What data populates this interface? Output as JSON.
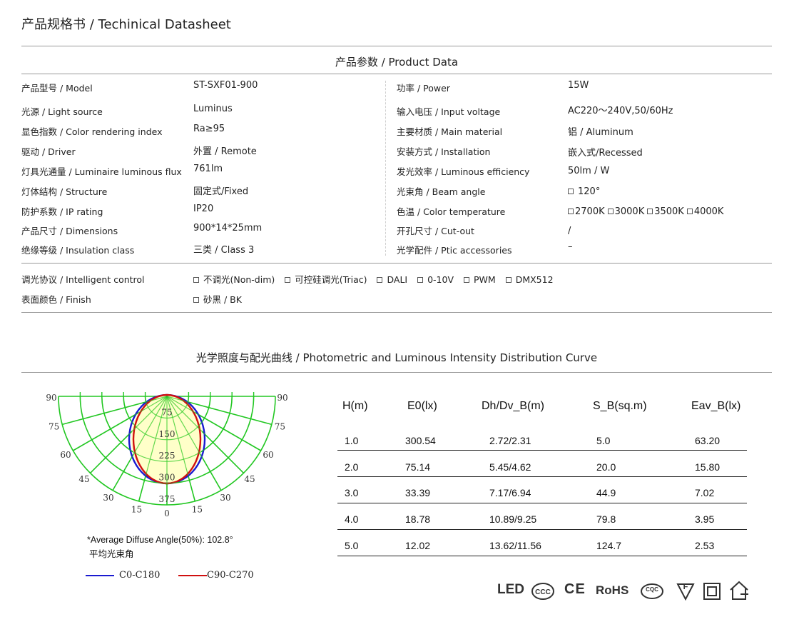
{
  "header": {
    "title": "产品规格书 / Techinical Datasheet"
  },
  "product_section": {
    "title": "产品参数 / Product Data"
  },
  "left_specs": [
    {
      "label": "产品型号 / Model",
      "value": "ST-SXF01-900"
    },
    {
      "label": "光源 / Light source",
      "value": "Luminus"
    },
    {
      "label": "显色指数 / Color rendering index",
      "value": "Ra≥95"
    },
    {
      "label": "驱动 / Driver",
      "value": "外置 / Remote"
    },
    {
      "label": "灯具光通量 / Luminaire luminous flux",
      "value": "761lm"
    },
    {
      "label": "灯体结构 / Structure",
      "value": "固定式/Fixed"
    },
    {
      "label": "防护系数 / IP rating",
      "value": "IP20"
    },
    {
      "label": "产品尺寸 / Dimensions",
      "value": "900*14*25mm"
    },
    {
      "label": "绝缘等级 / Insulation class",
      "value": "三类 / Class 3"
    }
  ],
  "right_specs": [
    {
      "label": "功率 / Power",
      "value": "15W"
    },
    {
      "label": "输入电压 / Input voltage",
      "value": "AC220～240V,50/60Hz"
    },
    {
      "label": "主要材质 / Main material",
      "value": "铝 / Aluminum"
    },
    {
      "label": "安装方式 / Installation",
      "value": "嵌入式/Recessed"
    },
    {
      "label": "发光效率 / Luminous efficiency",
      "value": "50lm / W"
    },
    {
      "label": "光束角 / Beam angle",
      "value": "120°"
    },
    {
      "label": "色温 / Color temperature",
      "value": ""
    },
    {
      "label": "开孔尺寸 / Cut-out",
      "value": "/"
    },
    {
      "label": "光学配件 / Ptic accessories",
      "value": "–"
    }
  ],
  "color_temps": [
    "2700K",
    "3000K",
    "3500K",
    "4000K"
  ],
  "control": {
    "label": "调光协议 / Intelligent control",
    "options": [
      "不调光(Non-dim)",
      "可控硅调光(Triac)",
      "DALI",
      "0-10V",
      "PWM",
      "DMX512"
    ]
  },
  "finish": {
    "label": "表面颜色 / Finish",
    "options": [
      "砂黑 / BK"
    ]
  },
  "photometric_section": {
    "title": "光学照度与配光曲线 / Photometric and Luminous Intensity Distribution Curve"
  },
  "polar": {
    "angle_labels": [
      "90",
      "75",
      "60",
      "45",
      "30",
      "15",
      "0",
      "15",
      "30",
      "45",
      "60",
      "75",
      "90"
    ],
    "radial_labels": [
      "75",
      "150",
      "225",
      "300",
      "375"
    ],
    "note_line1": "*Average Diffuse Angle(50%): 102.8°",
    "note_line2": "平均光束角",
    "legend": [
      {
        "name": "C0-C180",
        "color": "#1a1ad0"
      },
      {
        "name": "C90-C270",
        "color": "#d01010"
      }
    ],
    "grid_color": "#22c722"
  },
  "chart_data": {
    "type": "table",
    "headers": [
      "H(m)",
      "E0(lx)",
      "Dh/Dv_B(m)",
      "S_B(sq.m)",
      "Eav_B(lx)"
    ],
    "rows": [
      [
        "1.0",
        "300.54",
        "2.72/2.31",
        "5.0",
        "63.20"
      ],
      [
        "2.0",
        "75.14",
        "5.45/4.62",
        "20.0",
        "15.80"
      ],
      [
        "3.0",
        "33.39",
        "7.17/6.94",
        "44.9",
        "7.02"
      ],
      [
        "4.0",
        "18.78",
        "10.89/9.25",
        "79.8",
        "3.95"
      ],
      [
        "5.0",
        "12.02",
        "13.62/11.56",
        "124.7",
        "2.53"
      ]
    ]
  },
  "certifications": {
    "led": "LED",
    "ce": "CE",
    "rohs": "RoHS",
    "cqc": "CQC",
    "f": "F"
  }
}
